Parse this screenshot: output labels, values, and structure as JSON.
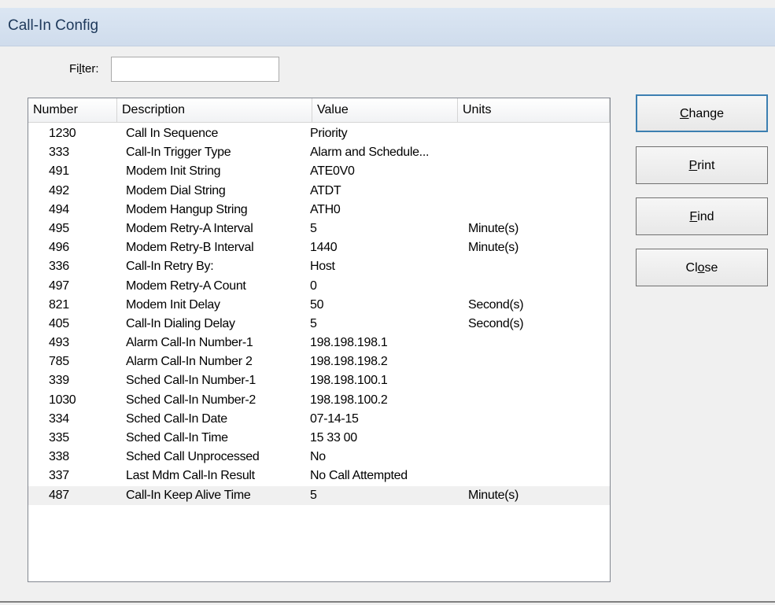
{
  "window": {
    "title": "Call-In Config"
  },
  "filter": {
    "label_pre": "Fi",
    "label_mn": "l",
    "label_post": "ter:",
    "value": ""
  },
  "columns": {
    "number": "Number",
    "description": "Description",
    "value": "Value",
    "units": "Units"
  },
  "rows": [
    {
      "number": "1230",
      "description": "Call In Sequence",
      "value": "Priority",
      "units": ""
    },
    {
      "number": "333",
      "description": "Call-In Trigger Type",
      "value": "Alarm and Schedule...",
      "units": ""
    },
    {
      "number": "491",
      "description": "Modem Init String",
      "value": "ATE0V0",
      "units": ""
    },
    {
      "number": "492",
      "description": "Modem Dial String",
      "value": "ATDT",
      "units": ""
    },
    {
      "number": "494",
      "description": "Modem Hangup String",
      "value": "ATH0",
      "units": ""
    },
    {
      "number": "495",
      "description": "Modem Retry-A Interval",
      "value": "5",
      "units": "Minute(s)"
    },
    {
      "number": "496",
      "description": "Modem Retry-B Interval",
      "value": "1440",
      "units": "Minute(s)"
    },
    {
      "number": "336",
      "description": "Call-In Retry By:",
      "value": "Host",
      "units": ""
    },
    {
      "number": "497",
      "description": "Modem Retry-A Count",
      "value": "0",
      "units": ""
    },
    {
      "number": "821",
      "description": "Modem Init Delay",
      "value": "50",
      "units": "Second(s)"
    },
    {
      "number": "405",
      "description": "Call-In Dialing Delay",
      "value": "5",
      "units": "Second(s)"
    },
    {
      "number": "493",
      "description": "Alarm Call-In Number-1",
      "value": "198.198.198.1",
      "units": ""
    },
    {
      "number": "785",
      "description": "Alarm Call-In Number 2",
      "value": "198.198.198.2",
      "units": ""
    },
    {
      "number": "339",
      "description": "Sched Call-In Number-1",
      "value": "198.198.100.1",
      "units": ""
    },
    {
      "number": "1030",
      "description": "Sched Call-In Number-2",
      "value": "198.198.100.2",
      "units": ""
    },
    {
      "number": "334",
      "description": "Sched Call-In Date",
      "value": "07-14-15",
      "units": ""
    },
    {
      "number": "335",
      "description": "Sched Call-In Time",
      "value": "15 33 00",
      "units": ""
    },
    {
      "number": "338",
      "description": "Sched Call Unprocessed",
      "value": "No",
      "units": ""
    },
    {
      "number": "337",
      "description": "Last Mdm Call-In Result",
      "value": "No Call Attempted",
      "units": ""
    },
    {
      "number": "487",
      "description": "Call-In Keep Alive Time",
      "value": "5",
      "units": "Minute(s)"
    }
  ],
  "buttons": {
    "change": {
      "mn": "C",
      "rest": "hange"
    },
    "print": {
      "mn": "P",
      "rest": "rint"
    },
    "find": {
      "mn": "F",
      "rest": "ind"
    },
    "close": {
      "pre": "Cl",
      "mn": "o",
      "rest": "se"
    }
  }
}
